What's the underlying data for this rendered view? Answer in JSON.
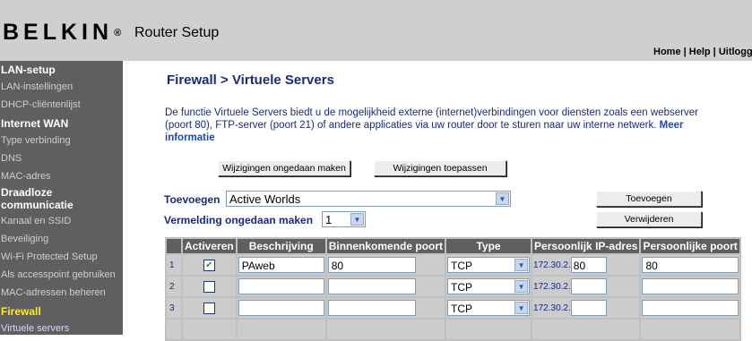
{
  "header": {
    "brand": "BELKIN",
    "brand_mark": "®",
    "title": "Router Setup",
    "links": [
      "Home",
      "Help",
      "Uitlogg"
    ]
  },
  "sidebar": {
    "lan_heading": "LAN-setup",
    "lan_items": [
      "LAN-instellingen",
      "DHCP-cliëntenlijst"
    ],
    "wan_heading": "Internet WAN",
    "wan_items": [
      "Type verbinding",
      "DNS",
      "MAC-adres"
    ],
    "wireless_heading_1": "Draadloze",
    "wireless_heading_2": "communicatie",
    "wireless_items": [
      "Kanaal en SSID",
      "Beveiliging",
      "Wi-Fi Protected Setup",
      "Als accesspoint gebruiken",
      "MAC-adressen beheren"
    ],
    "firewall_heading": "Firewall",
    "firewall_items": [
      "Virtuele servers"
    ]
  },
  "main": {
    "title": "Firewall > Virtuele Servers",
    "intro": "De functie Virtuele Servers biedt u de mogelijkheid externe (internet)verbindingen voor diensten zoals een webserver (poort 80), FTP-server (poort 21) of andere applicaties via uw router door te sturen naar uw interne netwerk.",
    "more_link": "Meer informatie",
    "undo_button": "Wijzigingen ongedaan maken",
    "apply_button": "Wijzigingen toepassen",
    "add_label": "Toevoegen",
    "add_value": "Active Worlds",
    "add_button": "Toevoegen",
    "remove_label": "Vermelding ongedaan maken",
    "remove_value": "1",
    "remove_button": "Verwijderen"
  },
  "table": {
    "headers": [
      "Activeren",
      "Beschrijving",
      "Binnenkomende poort",
      "Type",
      "Persoonlijk IP-adres",
      "Persoonlijke poort"
    ],
    "ip_prefix": "172.30.2.",
    "rows": [
      {
        "num": "1",
        "checked": true,
        "checkmark": "✔",
        "desc": "PAweb",
        "in_port": "80",
        "type": "TCP",
        "ip_last": "80",
        "priv_port": "80"
      },
      {
        "num": "2",
        "checked": false,
        "checkmark": "",
        "desc": "",
        "in_port": "",
        "type": "TCP",
        "ip_last": "",
        "priv_port": ""
      },
      {
        "num": "3",
        "checked": false,
        "checkmark": "",
        "desc": "",
        "in_port": "",
        "type": "TCP",
        "ip_last": "",
        "priv_port": ""
      }
    ]
  },
  "icons": {
    "dropdown": "chevron-down-icon",
    "checkbox_checked": "checkmark-icon"
  }
}
